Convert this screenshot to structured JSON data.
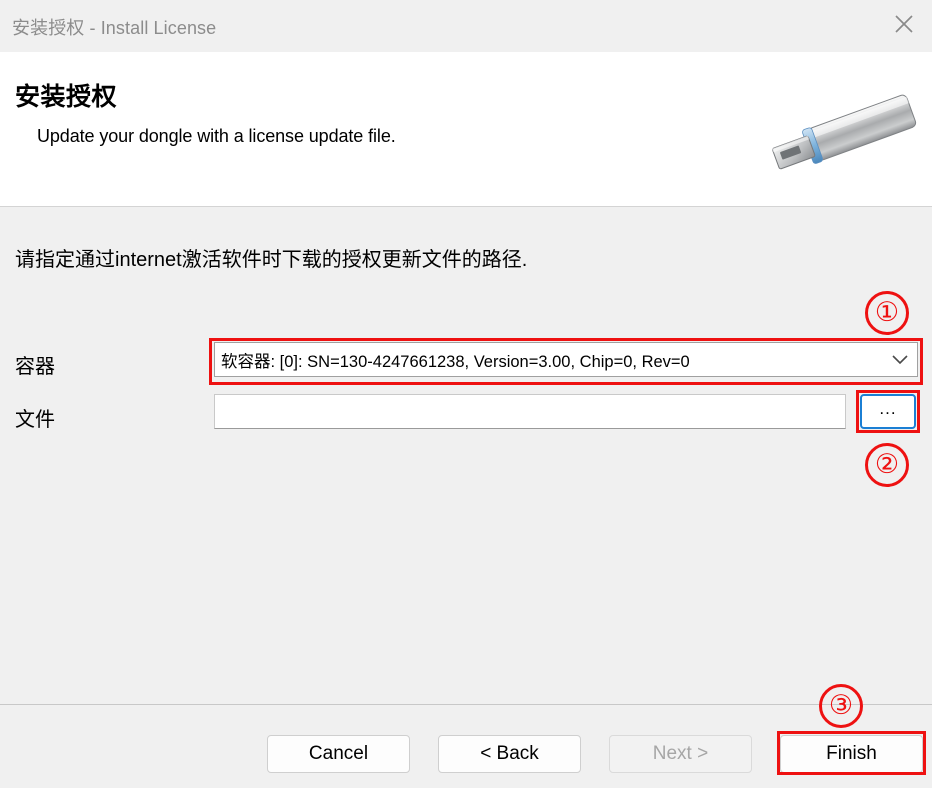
{
  "window": {
    "title_cn": "安装授权",
    "title_sep": " - ",
    "title_en": "Install License",
    "title_full": "安装授权 - Install License",
    "close_icon": "close-icon"
  },
  "header": {
    "heading": "安装授权",
    "subtitle": "Update your dongle with a license update file.",
    "illustration": "usb-dongle-icon"
  },
  "body": {
    "instruction": "请指定通过internet激活软件时下载的授权更新文件的路径.",
    "fields": {
      "container": {
        "label": "容器",
        "value": "软容器: [0]: SN=130-4247661238, Version=3.00, Chip=0, Rev=0",
        "dropdown_icon": "chevron-down-icon"
      },
      "file": {
        "label": "文件",
        "value": "",
        "placeholder": "",
        "browse_label": "..."
      }
    }
  },
  "footer": {
    "buttons": [
      {
        "id": "cancel",
        "label": "Cancel",
        "disabled": false
      },
      {
        "id": "back",
        "label": "< Back",
        "disabled": false
      },
      {
        "id": "next",
        "label": "Next >",
        "disabled": true
      },
      {
        "id": "finish",
        "label": "Finish",
        "disabled": false
      }
    ]
  },
  "annotations": {
    "color": "#ee1111",
    "markers": [
      {
        "number": "①",
        "target": "container-dropdown"
      },
      {
        "number": "②",
        "target": "browse-button"
      },
      {
        "number": "③",
        "target": "finish-button"
      }
    ]
  }
}
